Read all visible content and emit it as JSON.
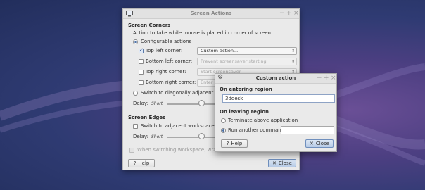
{
  "main_window": {
    "title": "Screen Actions",
    "controls": [
      "−",
      "+",
      "×"
    ],
    "screen_corners": {
      "heading": "Screen Corners",
      "description": "Action to take while mouse is placed in corner of screen",
      "configurable_label": "Configurable actions",
      "corners": [
        {
          "label": "Top left corner:",
          "value": "Custom action...",
          "checked": true
        },
        {
          "label": "Bottom left corner:",
          "value": "Prevent screensaver starting",
          "checked": false
        },
        {
          "label": "Top right corner:",
          "value": "Start screensaver",
          "checked": false
        },
        {
          "label": "Bottom right corner:",
          "value": "Enter D",
          "checked": false
        }
      ],
      "diagonal_label": "Switch to diagonally adjacent work",
      "delay_label": "Delay:",
      "delay_scale": "Short"
    },
    "screen_edges": {
      "heading": "Screen Edges",
      "adjacent_label": "Switch to adjacent workspace wh",
      "delay_label": "Delay:",
      "delay_scale": "Short",
      "wrap_label": "When switching workspace, wrap a"
    },
    "help_button": "Help",
    "close_button": "Close"
  },
  "custom_window": {
    "title": "Custom action",
    "controls": [
      "−",
      "+",
      "×"
    ],
    "entering_heading": "On entering region",
    "entering_value": "3ddesk",
    "leaving_heading": "On leaving region",
    "terminate_label": "Terminate above application",
    "run_label": "Run another command:",
    "run_value": "",
    "help_button": "Help",
    "close_button": "Close"
  },
  "icons": {
    "help": "?",
    "close": "✕",
    "gear": "⚙",
    "dropdown": "⇕"
  }
}
